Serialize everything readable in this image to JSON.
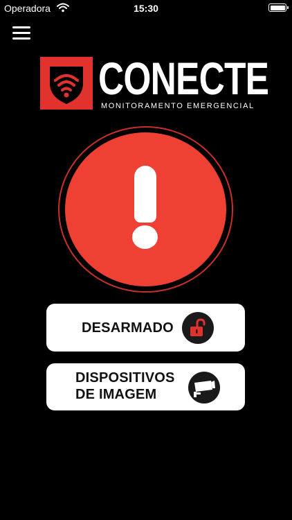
{
  "status_bar": {
    "carrier": "Operadora",
    "time": "15:30",
    "wifi_icon": "wifi-icon",
    "battery_icon": "battery-icon"
  },
  "header": {
    "menu_icon": "hamburger-menu-icon"
  },
  "brand": {
    "name": "CONECTE",
    "subtitle": "MONITORAMENTO EMERGENCIAL",
    "logo_icon": "shield-wifi-icon",
    "color": "#e2322d"
  },
  "alert": {
    "icon": "exclamation-icon",
    "color": "#ef4034"
  },
  "buttons": {
    "arm_status": {
      "label": "DESARMADO",
      "icon": "unlocked-padlock-icon",
      "icon_color": "#e2322d"
    },
    "cameras": {
      "label_line1": "DISPOSITIVOS",
      "label_line2": "DE IMAGEM",
      "icon": "security-camera-icon"
    }
  }
}
